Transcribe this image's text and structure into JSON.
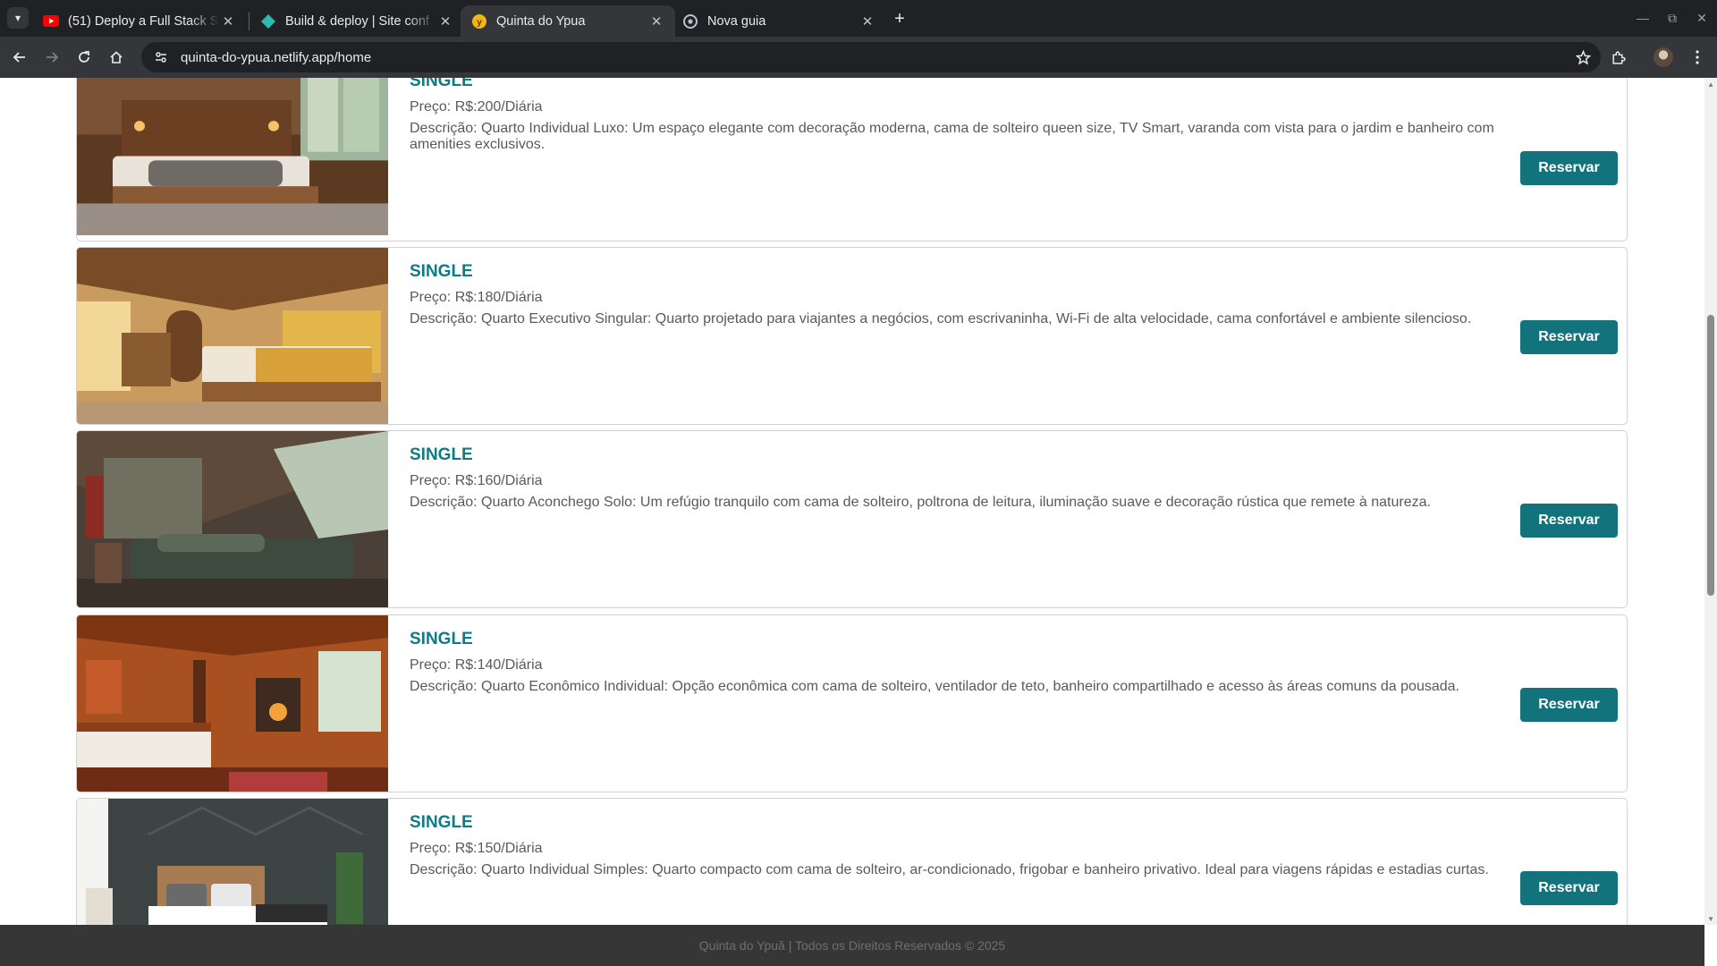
{
  "browser": {
    "tabs": [
      {
        "title": "(51) Deploy a Full Stack S",
        "favicon": "youtube-icon",
        "active": false
      },
      {
        "title": "Build & deploy | Site conf",
        "favicon": "netlify-icon",
        "active": false
      },
      {
        "title": "Quinta do Ypua",
        "favicon": "site-icon",
        "active": true
      },
      {
        "title": "Nova guia",
        "favicon": "chrome-icon",
        "active": false
      }
    ],
    "url": "quinta-do-ypua.netlify.app/home"
  },
  "rooms": [
    {
      "type": "SINGLE",
      "price": "Preço: R$:200/Diária",
      "description": "Descrição: Quarto Individual Luxo: Um espaço elegante com decoração moderna, cama de solteiro queen size, TV Smart, varanda com vista para o jardim e banheiro com amenities exclusivos.",
      "button": "Reservar"
    },
    {
      "type": "SINGLE",
      "price": "Preço: R$:180/Diária",
      "description": "Descrição: Quarto Executivo Singular: Quarto projetado para viajantes a negócios, com escrivaninha, Wi-Fi de alta velocidade, cama confortável e ambiente silencioso.",
      "button": "Reservar"
    },
    {
      "type": "SINGLE",
      "price": "Preço: R$:160/Diária",
      "description": "Descrição: Quarto Aconchego Solo: Um refúgio tranquilo com cama de solteiro, poltrona de leitura, iluminação suave e decoração rústica que remete à natureza.",
      "button": "Reservar"
    },
    {
      "type": "SINGLE",
      "price": "Preço: R$:140/Diária",
      "description": "Descrição: Quarto Econômico Individual: Opção econômica com cama de solteiro, ventilador de teto, banheiro compartilhado e acesso às áreas comuns da pousada.",
      "button": "Reservar"
    },
    {
      "type": "SINGLE",
      "price": "Preço: R$:150/Diária",
      "description": "Descrição: Quarto Individual Simples: Quarto compacto com cama de solteiro, ar-condicionado, frigobar e banheiro privativo. Ideal para viagens rápidas e estadias curtas.",
      "button": "Reservar"
    }
  ],
  "footer": "Quinta do Ypuã | Todos os Direitos Reservados © 2025",
  "colors": {
    "accent": "#0f7b86",
    "button": "#12737c",
    "footer_bg": "#363636"
  }
}
